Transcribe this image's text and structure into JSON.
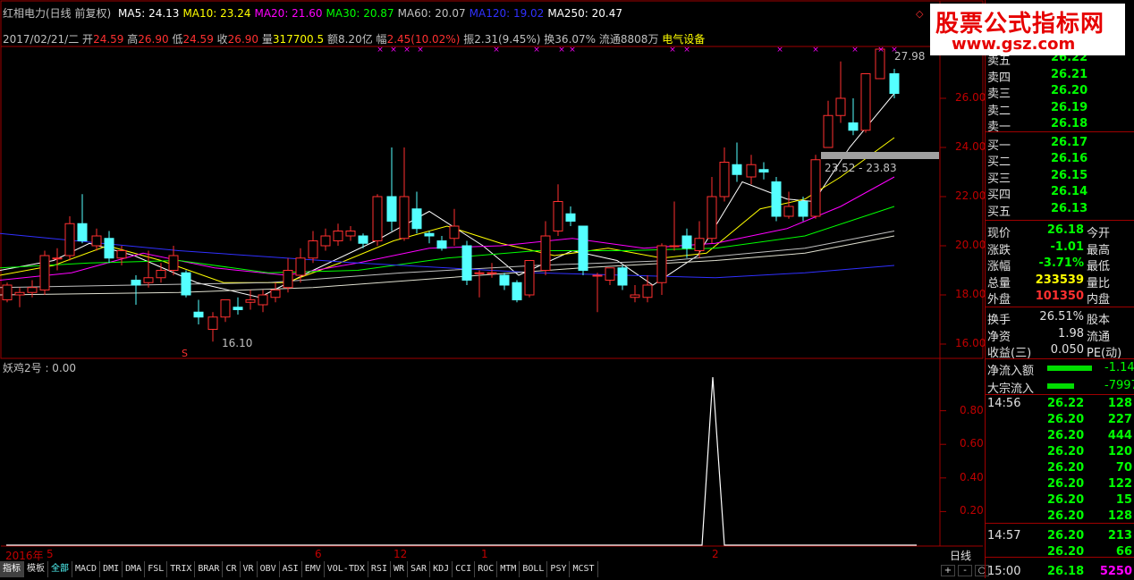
{
  "header": {
    "title": "红相电力(日线 前复权)",
    "ma": [
      {
        "label": "MA5: 24.13",
        "color": "#ffffff"
      },
      {
        "label": "MA10: 23.24",
        "color": "#ffff00"
      },
      {
        "label": "MA20: 21.60",
        "color": "#ff00ff"
      },
      {
        "label": "MA30: 20.87",
        "color": "#00ff00"
      },
      {
        "label": "MA60: 20.07",
        "color": "#c0c0c0"
      },
      {
        "label": "MA120: 19.02",
        "color": "#3030ff"
      },
      {
        "label": "MA250: 20.47",
        "color": "#ffffff"
      }
    ]
  },
  "info": {
    "date": "2017/02/21/二",
    "open_label": "开",
    "open": "24.59",
    "high_label": "高",
    "high": "26.90",
    "low_label": "低",
    "low": "24.59",
    "close_label": "收",
    "close": "26.90",
    "vol_label": "量",
    "vol": "317700.5",
    "amount_label": "额",
    "amount": "8.20亿",
    "change_label": "幅",
    "change": "2.45(10.02%)",
    "amp_label": "振",
    "amp": "2.31(9.45%)",
    "turnover_label": "换",
    "turnover": "36.07%",
    "float_label": "流通",
    "float": "8808万",
    "sector": "电气设备"
  },
  "annotations": {
    "high": "27.98",
    "low": "16.10",
    "band": "23.52 - 23.83",
    "s_mark": "S"
  },
  "price_axis": [
    "26.00",
    "24.00",
    "22.00",
    "20.00",
    "18.00",
    "16.00"
  ],
  "indicator": {
    "title": "妖鸡2号 : 0.00",
    "axis": [
      "0.80",
      "0.60",
      "0.40",
      "0.20"
    ]
  },
  "date_axis": [
    "2016年",
    "5",
    "6",
    "12",
    "1",
    "2"
  ],
  "period_label": "日线",
  "zoom_buttons": [
    "+",
    "-",
    "○"
  ],
  "tabs": [
    "指标",
    "模板",
    "全部",
    "MACD",
    "DMI",
    "DMA",
    "FSL",
    "TRIX",
    "BRAR",
    "CR",
    "VR",
    "OBV",
    "ASI",
    "EMV",
    "VOL-TDX",
    "RSI",
    "WR",
    "SAR",
    "KDJ",
    "CCI",
    "ROC",
    "MTM",
    "BOLL",
    "PSY",
    "MCST"
  ],
  "order_book": [
    {
      "label": "卖五",
      "price": "26.22"
    },
    {
      "label": "卖四",
      "price": "26.21"
    },
    {
      "label": "卖三",
      "price": "26.20"
    },
    {
      "label": "卖二",
      "price": "26.19"
    },
    {
      "label": "卖一",
      "price": "26.18"
    },
    {
      "label": "买一",
      "price": "26.17"
    },
    {
      "label": "买二",
      "price": "26.16"
    },
    {
      "label": "买三",
      "price": "26.15"
    },
    {
      "label": "买四",
      "price": "26.14"
    },
    {
      "label": "买五",
      "price": "26.13"
    }
  ],
  "quote": [
    {
      "l1": "现价",
      "v1": "26.18",
      "c1": "#00ff00",
      "l2": "今开",
      "v2": ""
    },
    {
      "l1": "涨跌",
      "v1": "-1.01",
      "c1": "#00ff00",
      "l2": "最高",
      "v2": ""
    },
    {
      "l1": "涨幅",
      "v1": "-3.71%",
      "c1": "#00ff00",
      "l2": "最低",
      "v2": ""
    },
    {
      "l1": "总量",
      "v1": "233539",
      "c1": "#ffff00",
      "l2": "量比",
      "v2": ""
    },
    {
      "l1": "外盘",
      "v1": "101350",
      "c1": "#ff3030",
      "l2": "内盘",
      "v2": ""
    }
  ],
  "stats": [
    {
      "l1": "换手",
      "v1": "26.51%",
      "l2": "股本"
    },
    {
      "l1": "净资",
      "v1": "1.98",
      "l2": "流通"
    },
    {
      "l1": "收益(三)",
      "v1": "0.050",
      "l2": "PE(动)"
    }
  ],
  "flow": [
    {
      "label": "净流入额",
      "value": "-1.14"
    },
    {
      "label": "大宗流入",
      "value": "-7997"
    }
  ],
  "ticks": [
    {
      "time": "14:56",
      "price": "26.22",
      "vol": "128"
    },
    {
      "time": "",
      "price": "26.20",
      "vol": "227"
    },
    {
      "time": "",
      "price": "26.20",
      "vol": "444"
    },
    {
      "time": "",
      "price": "26.20",
      "vol": "120"
    },
    {
      "time": "",
      "price": "26.20",
      "vol": "70"
    },
    {
      "time": "",
      "price": "26.20",
      "vol": "122"
    },
    {
      "time": "",
      "price": "26.20",
      "vol": "15"
    },
    {
      "time": "",
      "price": "26.20",
      "vol": "128"
    },
    {
      "time": "14:57",
      "price": "26.20",
      "vol": "213"
    },
    {
      "time": "",
      "price": "26.20",
      "vol": "66"
    },
    {
      "time": "15:00",
      "price": "26.18",
      "vol": "5250"
    }
  ],
  "watermark": {
    "title": "股票公式指标网",
    "url": "www.gsz.com"
  }
}
